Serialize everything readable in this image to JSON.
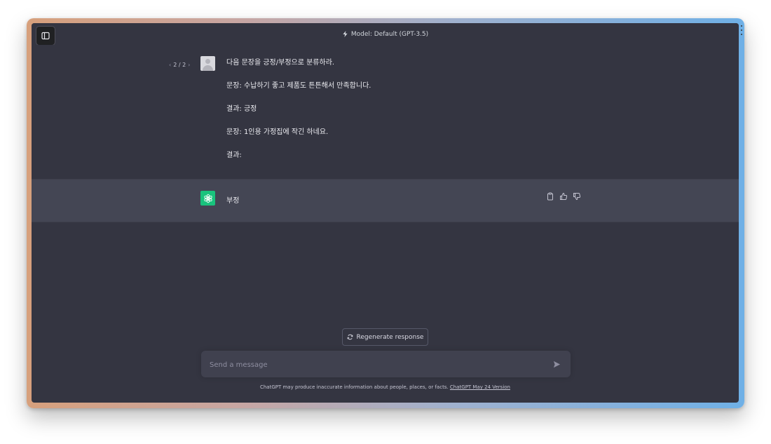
{
  "header": {
    "model_label": "Model: Default (GPT-3.5)",
    "bolt_icon": "lightning-bolt-icon",
    "sidebar_icon": "sidebar-toggle-icon"
  },
  "conversation": {
    "pager": {
      "current": "2",
      "total": "2",
      "text": "2 / 2"
    },
    "user_message": {
      "lines": [
        "다음 문장을 긍정/부정으로 분류하라.",
        "문장: 수납하기 좋고 제품도 튼튼해서 만족합니다.",
        "결과: 긍정",
        "문장: 1인용 가정집에 작긴 하네요.",
        "결과:"
      ]
    },
    "assistant_message": {
      "text": "부정",
      "actions": [
        "clipboard-icon",
        "thumbs-up-icon",
        "thumbs-down-icon"
      ]
    }
  },
  "controls": {
    "regenerate_label": "Regenerate response",
    "input_placeholder": "Send a message",
    "input_value": ""
  },
  "footer": {
    "disclaimer": "ChatGPT may produce inaccurate information about people, places, or facts. ",
    "version_link": "ChatGPT May 24 Version"
  },
  "colors": {
    "background": "#343541",
    "assistant_row": "#444654",
    "composer": "#40414f",
    "brand_green": "#19c37d"
  }
}
